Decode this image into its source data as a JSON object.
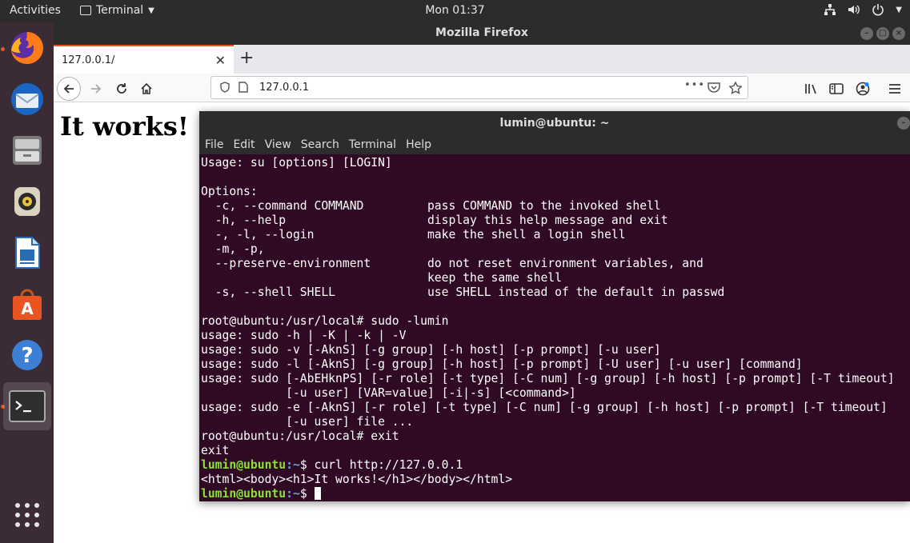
{
  "topbar": {
    "activities": "Activities",
    "app_menu": "Terminal",
    "clock": "Mon 01:37"
  },
  "dock": {
    "items": [
      "firefox-icon",
      "thunderbird-icon",
      "files-icon",
      "rhythmbox-icon",
      "libreoffice-writer-icon",
      "ubuntu-software-icon",
      "help-icon",
      "terminal-icon"
    ],
    "accent": "#e95420"
  },
  "firefox": {
    "window_title": "Mozilla Firefox",
    "tab_title": "127.0.0.1/",
    "url": "127.0.0.1",
    "url_ellipsis": "•••",
    "page_heading": "It works!"
  },
  "terminal": {
    "window_title": "lumin@ubuntu: ~",
    "menu": [
      "File",
      "Edit",
      "View",
      "Search",
      "Terminal",
      "Help"
    ],
    "background": "#300a24",
    "lines": [
      {
        "text": "Usage: su [options] [LOGIN]"
      },
      {
        "text": ""
      },
      {
        "text": "Options:"
      },
      {
        "text": "  -c, --command COMMAND         pass COMMAND to the invoked shell"
      },
      {
        "text": "  -h, --help                    display this help message and exit"
      },
      {
        "text": "  -, -l, --login                make the shell a login shell"
      },
      {
        "text": "  -m, -p,"
      },
      {
        "text": "  --preserve-environment        do not reset environment variables, and"
      },
      {
        "text": "                                keep the same shell"
      },
      {
        "text": "  -s, --shell SHELL             use SHELL instead of the default in passwd"
      },
      {
        "text": ""
      },
      {
        "text": "root@ubuntu:/usr/local# sudo -lumin"
      },
      {
        "text": "usage: sudo -h | -K | -k | -V"
      },
      {
        "text": "usage: sudo -v [-AknS] [-g group] [-h host] [-p prompt] [-u user]"
      },
      {
        "text": "usage: sudo -l [-AknS] [-g group] [-h host] [-p prompt] [-U user] [-u user] [command]"
      },
      {
        "text": "usage: sudo [-AbEHknPS] [-r role] [-t type] [-C num] [-g group] [-h host] [-p prompt] [-T timeout]"
      },
      {
        "text": "            [-u user] [VAR=value] [-i|-s] [<command>]"
      },
      {
        "text": "usage: sudo -e [-AknS] [-r role] [-t type] [-C num] [-g group] [-h host] [-p prompt] [-T timeout]"
      },
      {
        "text": "            [-u user] file ..."
      },
      {
        "text": "root@ubuntu:/usr/local# exit"
      },
      {
        "text": "exit"
      },
      {
        "user": "lumin@ubuntu",
        "path": ":~",
        "text": "$ curl http://127.0.0.1"
      },
      {
        "text": "<html><body><h1>It works!</h1></body></html>"
      },
      {
        "user": "lumin@ubuntu",
        "path": ":~",
        "text": "$ ",
        "cursor": true
      }
    ]
  }
}
